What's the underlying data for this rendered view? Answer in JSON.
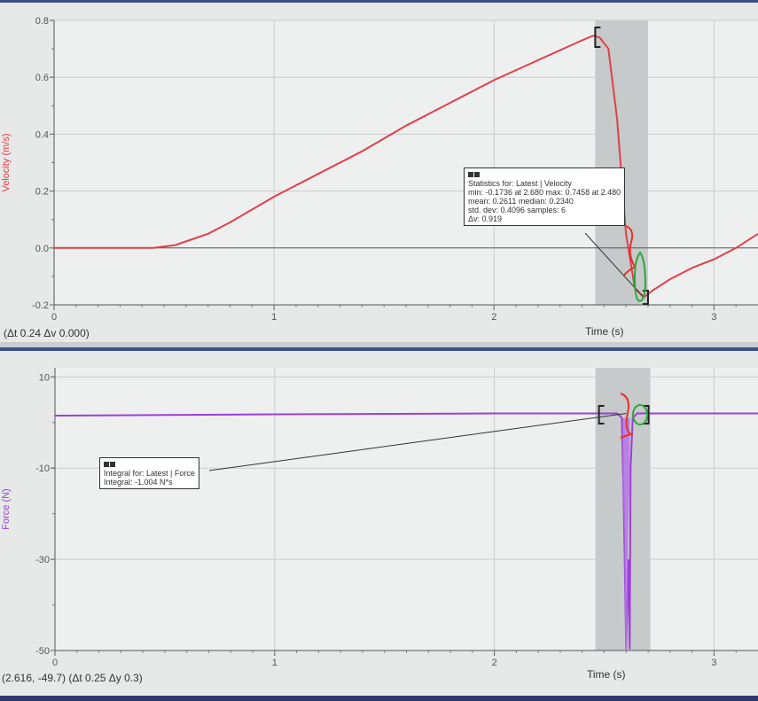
{
  "chart_data": [
    {
      "type": "line",
      "ylabel": "Velocity (m/s)",
      "xlabel": "Time (s)",
      "xlim": [
        0,
        3.2
      ],
      "ylim": [
        -0.2,
        0.8
      ],
      "x_ticks": [
        "0",
        "1",
        "2",
        "3"
      ],
      "y_ticks": [
        "0.8",
        "0.6",
        "0.4",
        "0.2",
        "0.0",
        "-0.2"
      ],
      "grid": true,
      "color": "#e0404a",
      "selection_range": [
        2.46,
        2.7
      ],
      "series": [
        {
          "x": [
            0,
            0.45,
            0.55,
            0.7,
            0.8,
            1.0,
            1.2,
            1.4,
            1.6,
            1.8,
            2.0,
            2.2,
            2.4,
            2.45,
            2.48,
            2.52,
            2.56,
            2.6,
            2.64,
            2.68,
            2.72,
            2.8,
            2.9,
            3.0,
            3.1,
            3.2
          ],
          "y": [
            0,
            0,
            0.01,
            0.05,
            0.09,
            0.18,
            0.26,
            0.34,
            0.43,
            0.51,
            0.59,
            0.66,
            0.73,
            0.746,
            0.74,
            0.7,
            0.45,
            0.05,
            -0.14,
            -0.1736,
            -0.15,
            -0.11,
            -0.07,
            -0.04,
            0.0,
            0.05
          ]
        }
      ],
      "status_text": "(Δt 0.24  Δv 0.000)",
      "stats_box": {
        "lines": [
          "Statistics for: Latest | Velocity",
          "min: -0.1736 at 2.680  max: 0.7458 at 2.480",
          "mean: 0.2611  median: 0.2340",
          "std. dev: 0.4096  samples: 6",
          "Δv: 0.919"
        ]
      }
    },
    {
      "type": "line",
      "ylabel": "Force (N)",
      "xlabel": "Time (s)",
      "xlim": [
        0,
        3.2
      ],
      "ylim": [
        -50,
        12
      ],
      "x_ticks": [
        "0",
        "1",
        "2",
        "3"
      ],
      "y_ticks": [
        "10",
        "-10",
        "-30",
        "-50"
      ],
      "grid": true,
      "color": "#9b3fd6",
      "selection_range": [
        2.46,
        2.71
      ],
      "series": [
        {
          "x": [
            0,
            1.0,
            2.0,
            2.56,
            2.58,
            2.59,
            2.6,
            2.61,
            2.616,
            2.62,
            2.63,
            2.65,
            3.2
          ],
          "y": [
            1.5,
            1.8,
            2.0,
            2.0,
            1.0,
            -20,
            -49.7,
            -30,
            -49.7,
            -10,
            1.0,
            2.0,
            2.0
          ]
        }
      ],
      "status_text": "(2.616, -49.7) (Δt 0.25  Δy 0.3)",
      "integral_box": {
        "lines": [
          "Integral for: Latest | Force",
          "Integral: -1.004 N*s"
        ]
      }
    }
  ]
}
